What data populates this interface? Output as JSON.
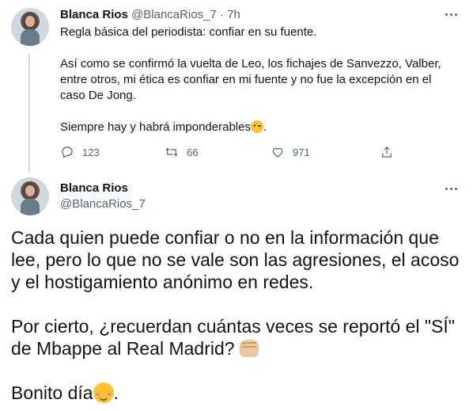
{
  "tweet1": {
    "display_name": "Blanca Rios",
    "handle": "@BlancaRios_7",
    "separator": "·",
    "time": "7h",
    "paragraphs": [
      "Regla básica del periodista: confiar en su fuente.",
      "Así como se confirmó la vuelta de Leo, los fichajes de Sanvezzo, Valber, entre otros, mi ética es confiar en mi fuente y no fue la excepción en el caso De Jong.",
      "Siempre hay y habrá imponderables"
    ],
    "last_paragraph_suffix": ".",
    "emoji": "winking-face",
    "replies": "123",
    "retweets": "66",
    "likes": "971"
  },
  "tweet2": {
    "display_name": "Blanca Rios",
    "handle": "@BlancaRios_7",
    "p1": "Cada quien puede confiar o no en la información que lee, pero lo que no se vale son las agresiones, el acoso y el hostigamiento anónimo en redes.",
    "p2": "Por cierto, ¿recuerdan cuántas veces se reportó  el \"SÍ\" de Mbappe al Real Madrid?",
    "p2_emoji": "oncoming-fist",
    "p3": "Bonito día",
    "p3_emoji": "smiling-face-with-blush",
    "p3_suffix": "."
  },
  "colors": {
    "text": "#0f1419",
    "muted": "#536471",
    "thread_line": "#cfd9de"
  }
}
